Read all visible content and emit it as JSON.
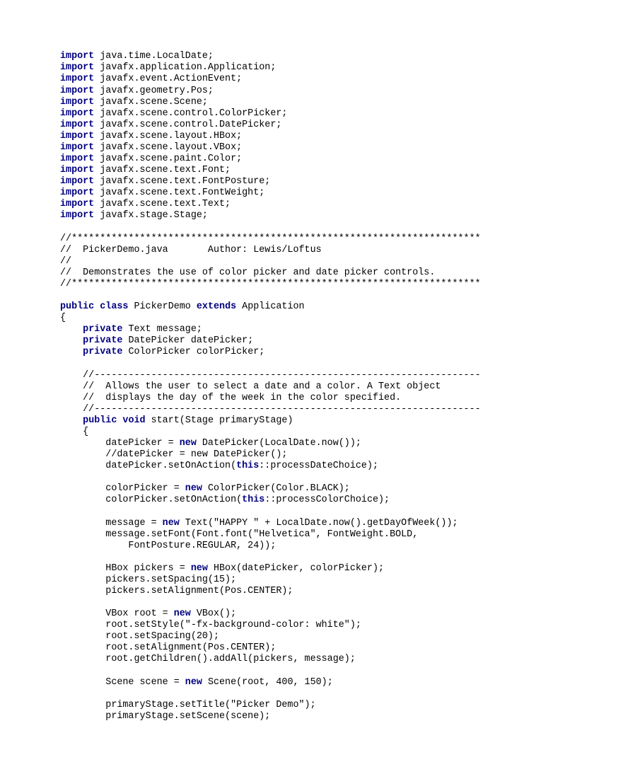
{
  "code": {
    "lines": [
      [
        {
          "t": "import",
          "c": "kw"
        },
        {
          "t": " java.time.LocalDate;",
          "c": ""
        }
      ],
      [
        {
          "t": "import",
          "c": "kw"
        },
        {
          "t": " javafx.application.Application;",
          "c": ""
        }
      ],
      [
        {
          "t": "import",
          "c": "kw"
        },
        {
          "t": " javafx.event.ActionEvent;",
          "c": ""
        }
      ],
      [
        {
          "t": "import",
          "c": "kw"
        },
        {
          "t": " javafx.geometry.Pos;",
          "c": ""
        }
      ],
      [
        {
          "t": "import",
          "c": "kw"
        },
        {
          "t": " javafx.scene.Scene;",
          "c": ""
        }
      ],
      [
        {
          "t": "import",
          "c": "kw"
        },
        {
          "t": " javafx.scene.control.ColorPicker;",
          "c": ""
        }
      ],
      [
        {
          "t": "import",
          "c": "kw"
        },
        {
          "t": " javafx.scene.control.DatePicker;",
          "c": ""
        }
      ],
      [
        {
          "t": "import",
          "c": "kw"
        },
        {
          "t": " javafx.scene.layout.HBox;",
          "c": ""
        }
      ],
      [
        {
          "t": "import",
          "c": "kw"
        },
        {
          "t": " javafx.scene.layout.VBox;",
          "c": ""
        }
      ],
      [
        {
          "t": "import",
          "c": "kw"
        },
        {
          "t": " javafx.scene.paint.Color;",
          "c": ""
        }
      ],
      [
        {
          "t": "import",
          "c": "kw"
        },
        {
          "t": " javafx.scene.text.Font;",
          "c": ""
        }
      ],
      [
        {
          "t": "import",
          "c": "kw"
        },
        {
          "t": " javafx.scene.text.FontPosture;",
          "c": ""
        }
      ],
      [
        {
          "t": "import",
          "c": "kw"
        },
        {
          "t": " javafx.scene.text.FontWeight;",
          "c": ""
        }
      ],
      [
        {
          "t": "import",
          "c": "kw"
        },
        {
          "t": " javafx.scene.text.Text;",
          "c": ""
        }
      ],
      [
        {
          "t": "import",
          "c": "kw"
        },
        {
          "t": " javafx.stage.Stage;",
          "c": ""
        }
      ],
      [
        {
          "t": "",
          "c": ""
        }
      ],
      [
        {
          "t": "//************************************************************************",
          "c": ""
        }
      ],
      [
        {
          "t": "//  PickerDemo.java       Author: Lewis/Loftus",
          "c": ""
        }
      ],
      [
        {
          "t": "//",
          "c": ""
        }
      ],
      [
        {
          "t": "//  Demonstrates the use of color picker and date picker controls.",
          "c": ""
        }
      ],
      [
        {
          "t": "//************************************************************************",
          "c": ""
        }
      ],
      [
        {
          "t": "",
          "c": ""
        }
      ],
      [
        {
          "t": "public",
          "c": "kw"
        },
        {
          "t": " ",
          "c": ""
        },
        {
          "t": "class",
          "c": "kw"
        },
        {
          "t": " PickerDemo ",
          "c": ""
        },
        {
          "t": "extends",
          "c": "kw"
        },
        {
          "t": " Application",
          "c": ""
        }
      ],
      [
        {
          "t": "{",
          "c": ""
        }
      ],
      [
        {
          "t": "    ",
          "c": ""
        },
        {
          "t": "private",
          "c": "kw"
        },
        {
          "t": " Text message;",
          "c": ""
        }
      ],
      [
        {
          "t": "    ",
          "c": ""
        },
        {
          "t": "private",
          "c": "kw"
        },
        {
          "t": " DatePicker datePicker;",
          "c": ""
        }
      ],
      [
        {
          "t": "    ",
          "c": ""
        },
        {
          "t": "private",
          "c": "kw"
        },
        {
          "t": " ColorPicker colorPicker;",
          "c": ""
        }
      ],
      [
        {
          "t": "",
          "c": ""
        }
      ],
      [
        {
          "t": "    //--------------------------------------------------------------------",
          "c": ""
        }
      ],
      [
        {
          "t": "    //  Allows the user to select a date and a color. A Text object",
          "c": ""
        }
      ],
      [
        {
          "t": "    //  displays the day of the week in the color specified.",
          "c": ""
        }
      ],
      [
        {
          "t": "    //--------------------------------------------------------------------",
          "c": ""
        }
      ],
      [
        {
          "t": "    ",
          "c": ""
        },
        {
          "t": "public",
          "c": "kw"
        },
        {
          "t": " ",
          "c": ""
        },
        {
          "t": "void",
          "c": "kw"
        },
        {
          "t": " start(Stage primaryStage)",
          "c": ""
        }
      ],
      [
        {
          "t": "    {",
          "c": ""
        }
      ],
      [
        {
          "t": "        datePicker = ",
          "c": ""
        },
        {
          "t": "new",
          "c": "kw"
        },
        {
          "t": " DatePicker(LocalDate.now());",
          "c": ""
        }
      ],
      [
        {
          "t": "        //datePicker = new DatePicker();",
          "c": ""
        }
      ],
      [
        {
          "t": "        datePicker.setOnAction(",
          "c": ""
        },
        {
          "t": "this",
          "c": "kw"
        },
        {
          "t": "::processDateChoice);",
          "c": ""
        }
      ],
      [
        {
          "t": "",
          "c": ""
        }
      ],
      [
        {
          "t": "        colorPicker = ",
          "c": ""
        },
        {
          "t": "new",
          "c": "kw"
        },
        {
          "t": " ColorPicker(Color.BLACK);",
          "c": ""
        }
      ],
      [
        {
          "t": "        colorPicker.setOnAction(",
          "c": ""
        },
        {
          "t": "this",
          "c": "kw"
        },
        {
          "t": "::processColorChoice);",
          "c": ""
        }
      ],
      [
        {
          "t": "",
          "c": ""
        }
      ],
      [
        {
          "t": "        message = ",
          "c": ""
        },
        {
          "t": "new",
          "c": "kw"
        },
        {
          "t": " Text(\"HAPPY \" + LocalDate.now().getDayOfWeek());",
          "c": ""
        }
      ],
      [
        {
          "t": "        message.setFont(Font.font(\"Helvetica\", FontWeight.BOLD,",
          "c": ""
        }
      ],
      [
        {
          "t": "            FontPosture.REGULAR, 24));",
          "c": ""
        }
      ],
      [
        {
          "t": "",
          "c": ""
        }
      ],
      [
        {
          "t": "        HBox pickers = ",
          "c": ""
        },
        {
          "t": "new",
          "c": "kw"
        },
        {
          "t": " HBox(datePicker, colorPicker);",
          "c": ""
        }
      ],
      [
        {
          "t": "        pickers.setSpacing(15);",
          "c": ""
        }
      ],
      [
        {
          "t": "        pickers.setAlignment(Pos.CENTER);",
          "c": ""
        }
      ],
      [
        {
          "t": "",
          "c": ""
        }
      ],
      [
        {
          "t": "        VBox root = ",
          "c": ""
        },
        {
          "t": "new",
          "c": "kw"
        },
        {
          "t": " VBox();",
          "c": ""
        }
      ],
      [
        {
          "t": "        root.setStyle(\"-fx-background-color: white\");",
          "c": ""
        }
      ],
      [
        {
          "t": "        root.setSpacing(20);",
          "c": ""
        }
      ],
      [
        {
          "t": "        root.setAlignment(Pos.CENTER);",
          "c": ""
        }
      ],
      [
        {
          "t": "        root.getChildren().addAll(pickers, message);",
          "c": ""
        }
      ],
      [
        {
          "t": "",
          "c": ""
        }
      ],
      [
        {
          "t": "        Scene scene = ",
          "c": ""
        },
        {
          "t": "new",
          "c": "kw"
        },
        {
          "t": " Scene(root, 400, 150);",
          "c": ""
        }
      ],
      [
        {
          "t": "",
          "c": ""
        }
      ],
      [
        {
          "t": "        primaryStage.setTitle(\"Picker Demo\");",
          "c": ""
        }
      ],
      [
        {
          "t": "        primaryStage.setScene(scene);",
          "c": ""
        }
      ]
    ]
  }
}
